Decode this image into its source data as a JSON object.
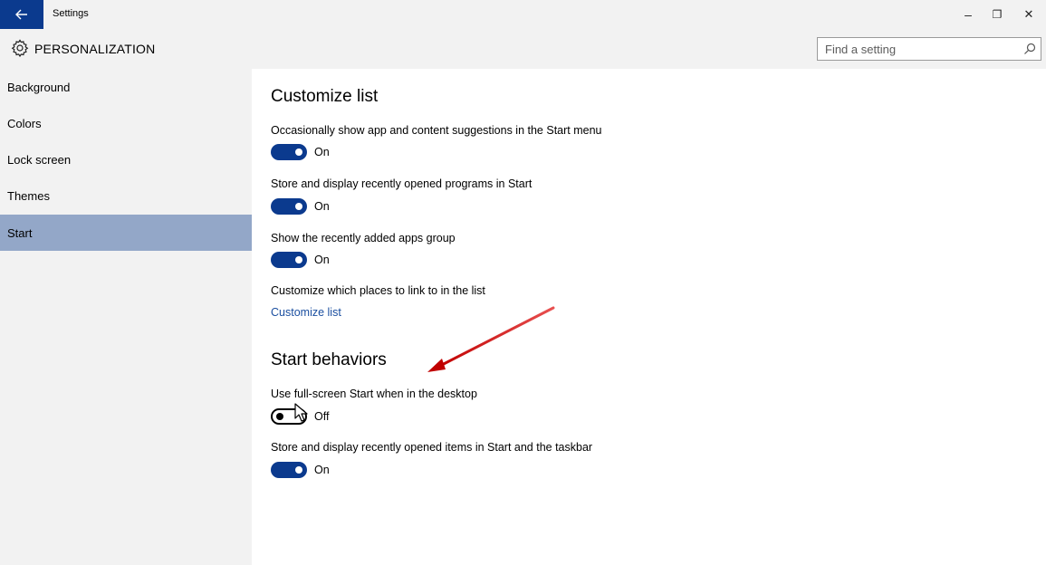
{
  "window": {
    "title": "Settings",
    "controls": {
      "minimize_glyph": "–",
      "restore_glyph": "❐",
      "close_glyph": "✕"
    }
  },
  "header": {
    "title": "PERSONALIZATION",
    "icon": "gear-icon"
  },
  "search": {
    "placeholder": "Find a setting",
    "value": "",
    "icon": "search-icon"
  },
  "sidebar": {
    "items": [
      {
        "label": "Background",
        "selected": false
      },
      {
        "label": "Colors",
        "selected": false
      },
      {
        "label": "Lock screen",
        "selected": false
      },
      {
        "label": "Themes",
        "selected": false
      },
      {
        "label": "Start",
        "selected": true
      }
    ]
  },
  "content": {
    "customize_list": {
      "title": "Customize list",
      "settings": [
        {
          "label": "Occasionally show app and content suggestions in the Start menu",
          "state": "On"
        },
        {
          "label": "Store and display recently opened programs in Start",
          "state": "On"
        },
        {
          "label": "Show the recently added apps group",
          "state": "On"
        }
      ],
      "places_label": "Customize which places to link to in the list",
      "places_link": "Customize list"
    },
    "start_behaviors": {
      "title": "Start behaviors",
      "settings": [
        {
          "label": "Use full-screen Start when in the desktop",
          "state": "Off"
        },
        {
          "label": "Store and display recently opened items in Start and the taskbar",
          "state": "On"
        }
      ]
    }
  },
  "colors": {
    "accent": "#0b3a8e",
    "selected_nav": "#93a7c8",
    "link": "#1b4fa0",
    "annotation_arrow": "#d01010"
  }
}
